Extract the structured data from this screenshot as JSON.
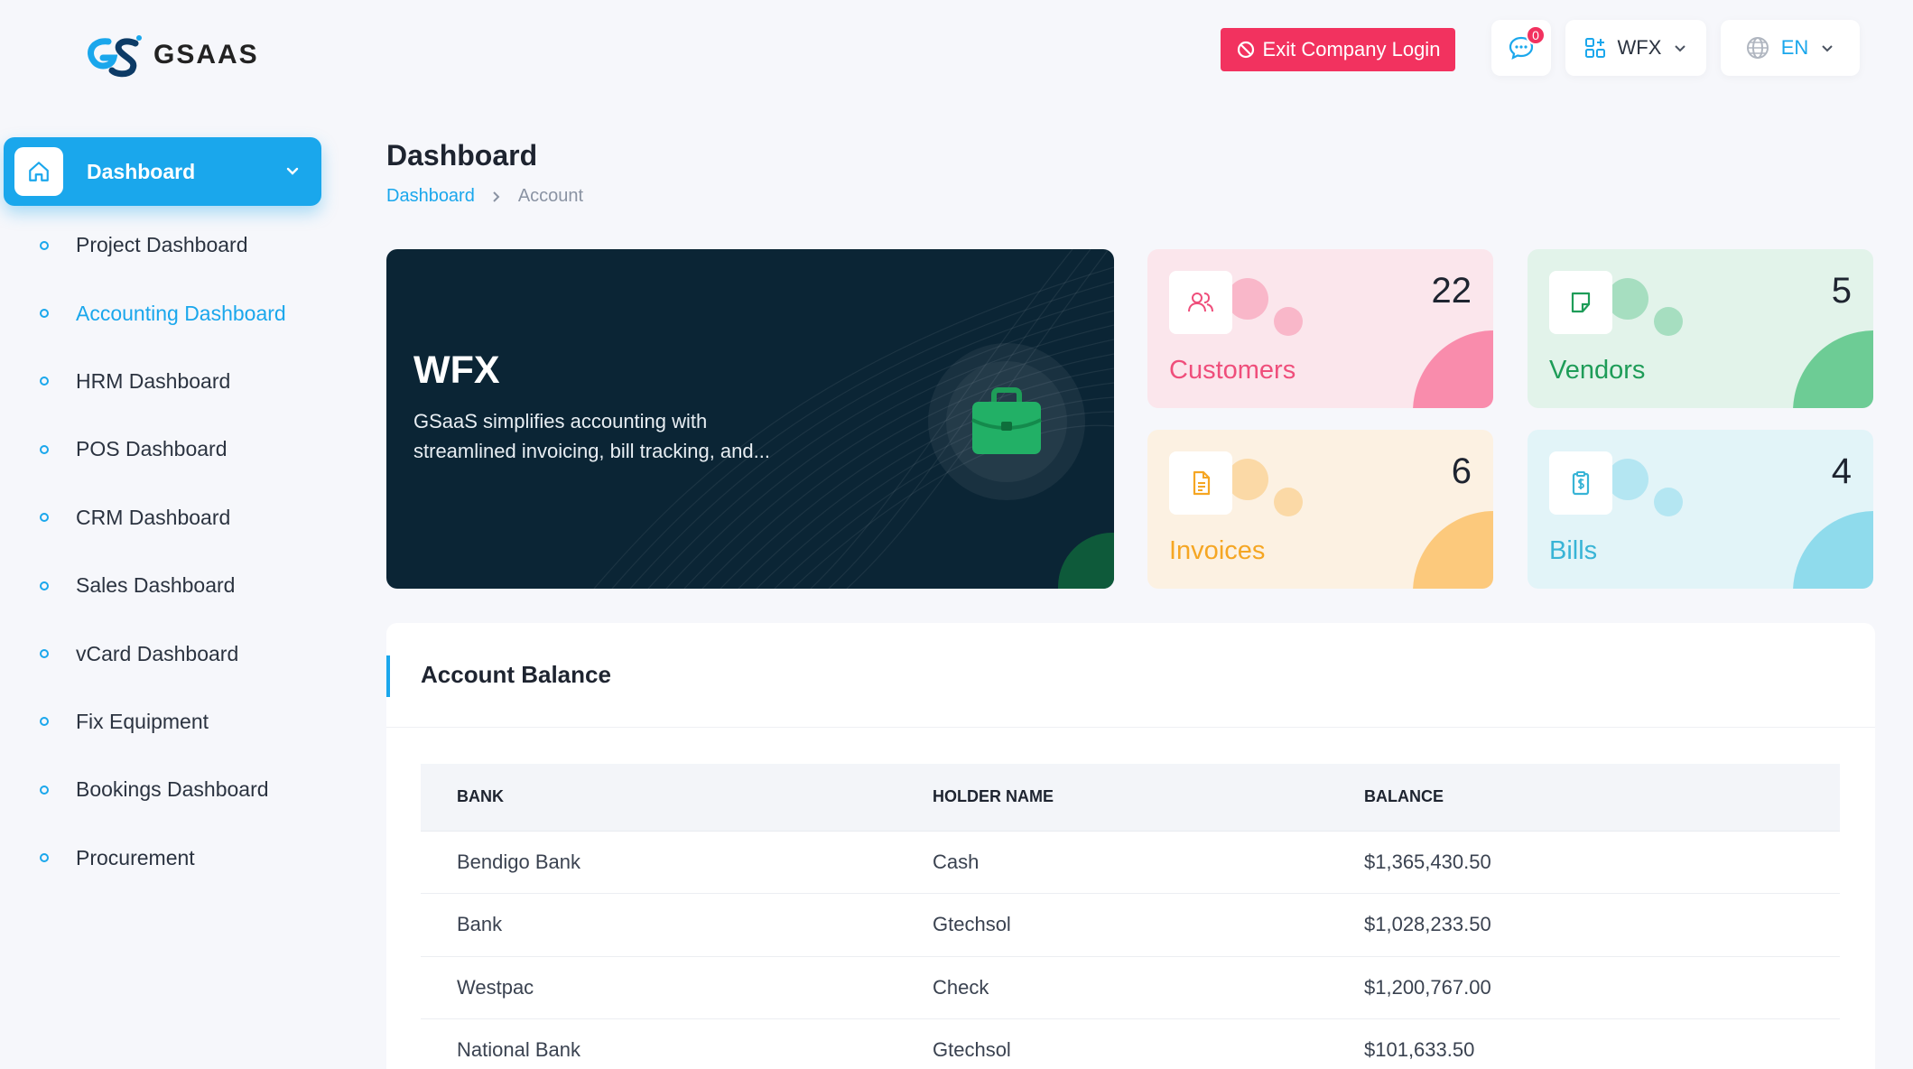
{
  "brand": {
    "name": "GSAAS"
  },
  "header": {
    "exit_label": "Exit Company Login",
    "chat_badge": "0",
    "workspace": "WFX",
    "language": "EN"
  },
  "sidebar": {
    "active_label": "Dashboard",
    "items": [
      {
        "label": "Project Dashboard",
        "active": false
      },
      {
        "label": "Accounting Dashboard",
        "active": true
      },
      {
        "label": "HRM Dashboard",
        "active": false
      },
      {
        "label": "POS Dashboard",
        "active": false
      },
      {
        "label": "CRM Dashboard",
        "active": false
      },
      {
        "label": "Sales Dashboard",
        "active": false
      },
      {
        "label": "vCard Dashboard",
        "active": false
      },
      {
        "label": "Fix Equipment",
        "active": false
      },
      {
        "label": "Bookings Dashboard",
        "active": false
      },
      {
        "label": "Procurement",
        "active": false
      }
    ]
  },
  "page": {
    "title": "Dashboard",
    "breadcrumb": [
      "Dashboard",
      "Account"
    ]
  },
  "hero": {
    "title": "WFX",
    "description": "GSaaS simplifies accounting with streamlined invoicing, bill tracking, and..."
  },
  "stats": {
    "customers": {
      "label": "Customers",
      "count": "22",
      "icon": "users-icon"
    },
    "vendors": {
      "label": "Vendors",
      "count": "5",
      "icon": "note-icon"
    },
    "invoices": {
      "label": "Invoices",
      "count": "6",
      "icon": "file-icon"
    },
    "bills": {
      "label": "Bills",
      "count": "4",
      "icon": "clipboard-dollar-icon"
    }
  },
  "account_balance": {
    "title": "Account Balance",
    "columns": [
      "BANK",
      "HOLDER NAME",
      "BALANCE"
    ],
    "rows": [
      [
        "Bendigo Bank",
        "Cash",
        "$1,365,430.50"
      ],
      [
        "Bank",
        "Gtechsol",
        "$1,028,233.50"
      ],
      [
        "Westpac",
        "Check",
        "$1,200,767.00"
      ],
      [
        "National Bank",
        "Gtechsol",
        "$101,633.50"
      ]
    ]
  },
  "colors": {
    "accent": "#1aa7ec",
    "danger": "#f2325f",
    "hero_bg": "#0b2535"
  }
}
